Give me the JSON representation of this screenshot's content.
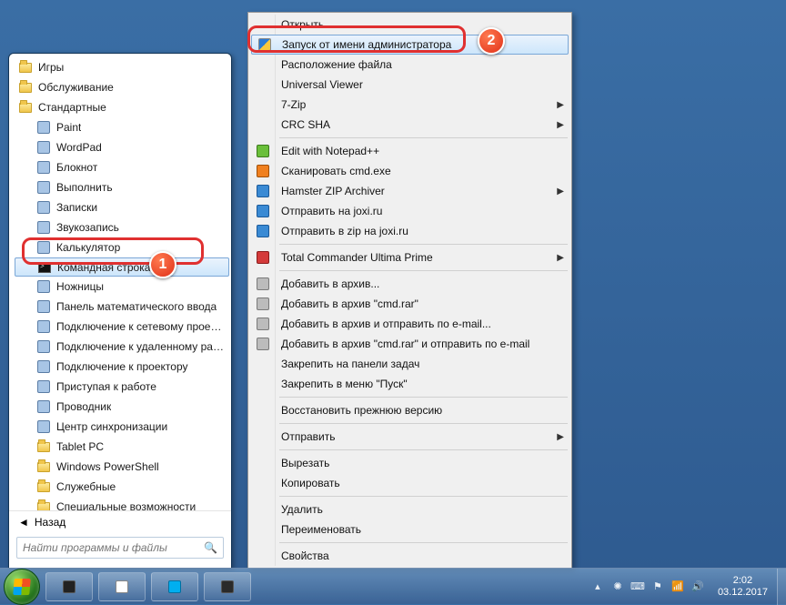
{
  "start_menu": {
    "items": [
      {
        "label": "Игры",
        "type": "folder",
        "indent": 0
      },
      {
        "label": "Обслуживание",
        "type": "folder",
        "indent": 0
      },
      {
        "label": "Стандартные",
        "type": "folder",
        "indent": 0
      },
      {
        "label": "Paint",
        "type": "app",
        "icon": "paint",
        "indent": 1
      },
      {
        "label": "WordPad",
        "type": "app",
        "icon": "wordpad",
        "indent": 1
      },
      {
        "label": "Блокнот",
        "type": "app",
        "icon": "notepad",
        "indent": 1
      },
      {
        "label": "Выполнить",
        "type": "app",
        "icon": "run",
        "indent": 1
      },
      {
        "label": "Записки",
        "type": "app",
        "icon": "sticky",
        "indent": 1
      },
      {
        "label": "Звукозапись",
        "type": "app",
        "icon": "sound",
        "indent": 1
      },
      {
        "label": "Калькулятор",
        "type": "app",
        "icon": "calc",
        "indent": 1
      },
      {
        "label": "Командная строка",
        "type": "app",
        "icon": "cmd",
        "indent": 1,
        "highlight": true
      },
      {
        "label": "Ножницы",
        "type": "app",
        "icon": "snip",
        "indent": 1
      },
      {
        "label": "Панель математического ввода",
        "type": "app",
        "icon": "math",
        "indent": 1
      },
      {
        "label": "Подключение к сетевому проектору",
        "type": "app",
        "icon": "netproj",
        "indent": 1
      },
      {
        "label": "Подключение к удаленному рабочему столу",
        "type": "app",
        "icon": "rdp",
        "indent": 1
      },
      {
        "label": "Подключение к проектору",
        "type": "app",
        "icon": "proj",
        "indent": 1
      },
      {
        "label": "Приступая к работе",
        "type": "app",
        "icon": "getting",
        "indent": 1
      },
      {
        "label": "Проводник",
        "type": "app",
        "icon": "explorer",
        "indent": 1
      },
      {
        "label": "Центр синхронизации",
        "type": "app",
        "icon": "sync",
        "indent": 1
      },
      {
        "label": "Tablet PC",
        "type": "folder",
        "indent": 1
      },
      {
        "label": "Windows PowerShell",
        "type": "folder",
        "indent": 1
      },
      {
        "label": "Служебные",
        "type": "folder",
        "indent": 1
      },
      {
        "label": "Специальные возможности",
        "type": "folder",
        "indent": 1
      }
    ],
    "back_label": "Назад",
    "search_placeholder": "Найти программы и файлы"
  },
  "context_menu": {
    "items": [
      {
        "label": "Открыть"
      },
      {
        "label": "Запуск от имени администратора",
        "icon": "shield",
        "highlight": true
      },
      {
        "label": "Расположение файла"
      },
      {
        "label": "Universal Viewer"
      },
      {
        "label": "7-Zip",
        "submenu": true
      },
      {
        "label": "CRC SHA",
        "submenu": true
      },
      {
        "sep": true
      },
      {
        "label": "Edit with Notepad++",
        "icon": "green"
      },
      {
        "label": "Сканировать cmd.exe",
        "icon": "orange"
      },
      {
        "label": "Hamster ZIP Archiver",
        "icon": "blue",
        "submenu": true
      },
      {
        "label": "Отправить на joxi.ru",
        "icon": "blue"
      },
      {
        "label": "Отправить в zip на joxi.ru",
        "icon": "blue"
      },
      {
        "sep": true
      },
      {
        "label": "Total Commander Ultima Prime",
        "icon": "red",
        "submenu": true
      },
      {
        "sep": true
      },
      {
        "label": "Добавить в архив...",
        "icon": "gray"
      },
      {
        "label": "Добавить в архив \"cmd.rar\"",
        "icon": "gray"
      },
      {
        "label": "Добавить в архив и отправить по e-mail...",
        "icon": "gray"
      },
      {
        "label": "Добавить в архив \"cmd.rar\" и отправить по e-mail",
        "icon": "gray"
      },
      {
        "label": "Закрепить на панели задач"
      },
      {
        "label": "Закрепить в меню \"Пуск\""
      },
      {
        "sep": true
      },
      {
        "label": "Восстановить прежнюю версию"
      },
      {
        "sep": true
      },
      {
        "label": "Отправить",
        "submenu": true
      },
      {
        "sep": true
      },
      {
        "label": "Вырезать"
      },
      {
        "label": "Копировать"
      },
      {
        "sep": true
      },
      {
        "label": "Удалить"
      },
      {
        "label": "Переименовать"
      },
      {
        "sep": true
      },
      {
        "label": "Свойства"
      }
    ]
  },
  "taskbar": {
    "time": "2:02",
    "date": "03.12.2017"
  },
  "markers": {
    "m1": "1",
    "m2": "2"
  }
}
